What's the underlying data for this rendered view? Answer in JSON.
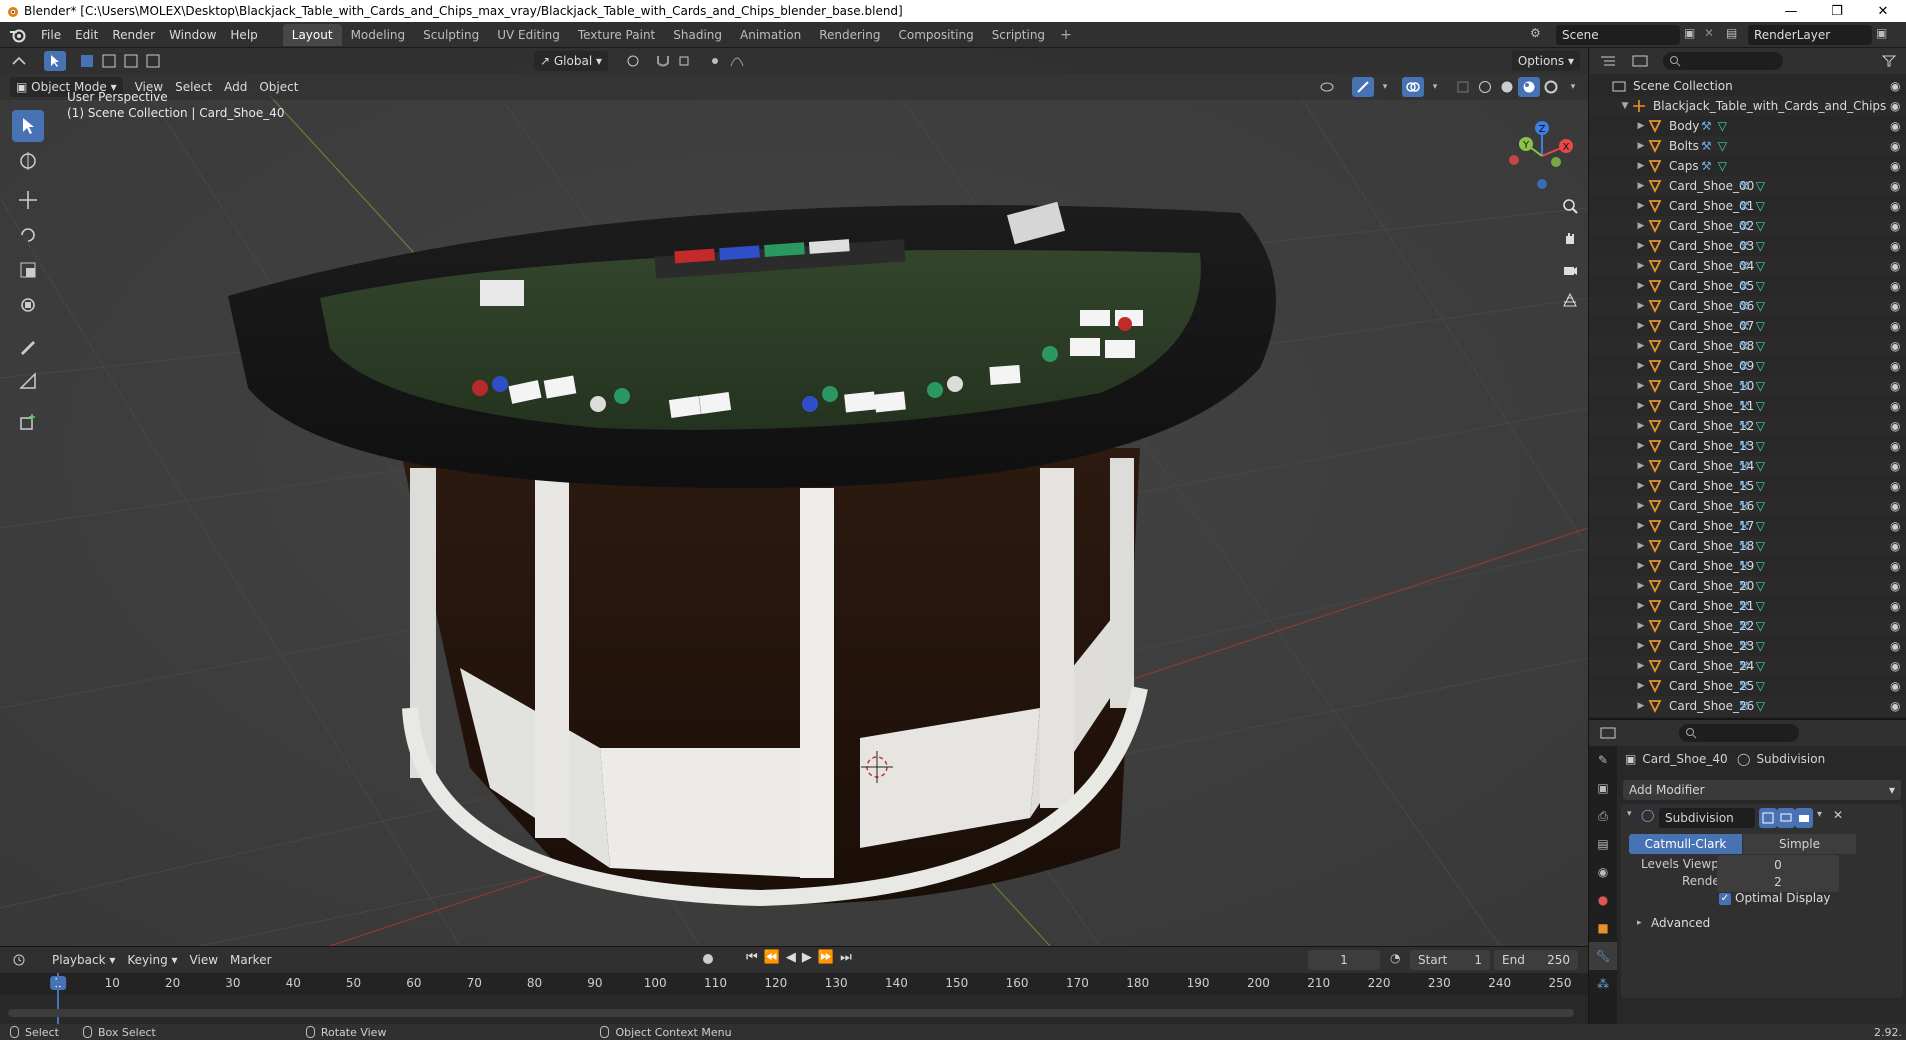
{
  "window": {
    "title": "Blender* [C:\\Users\\MOLEX\\Desktop\\Blackjack_Table_with_Cards_and_Chips_max_vray/Blackjack_Table_with_Cards_and_Chips_blender_base.blend]",
    "minimize": "—",
    "maximize": "❐",
    "close": "✕"
  },
  "menu": [
    "File",
    "Edit",
    "Render",
    "Window",
    "Help"
  ],
  "workspaces": [
    "Layout",
    "Modeling",
    "Sculpting",
    "UV Editing",
    "Texture Paint",
    "Shading",
    "Animation",
    "Rendering",
    "Compositing",
    "Scripting"
  ],
  "active_workspace": "Layout",
  "scene": {
    "name": "Scene",
    "render_layer": "RenderLayer"
  },
  "viewport": {
    "orientation": "Global",
    "options": "Options",
    "mode": "Object Mode",
    "menus": [
      "View",
      "Select",
      "Add",
      "Object"
    ],
    "info_line1": "User Perspective",
    "info_line2": "(1) Scene Collection | Card_Shoe_40",
    "axes": {
      "x": "X",
      "y": "Y",
      "z": "Z"
    }
  },
  "outliner": {
    "root": "Scene Collection",
    "collection": "Blackjack_Table_with_Cards_and_Chips",
    "items": [
      "Body",
      "Bolts",
      "Caps",
      "Card_Shoe_00",
      "Card_Shoe_01",
      "Card_Shoe_02",
      "Card_Shoe_03",
      "Card_Shoe_04",
      "Card_Shoe_05",
      "Card_Shoe_06",
      "Card_Shoe_07",
      "Card_Shoe_08",
      "Card_Shoe_09",
      "Card_Shoe_10",
      "Card_Shoe_11",
      "Card_Shoe_12",
      "Card_Shoe_13",
      "Card_Shoe_14",
      "Card_Shoe_15",
      "Card_Shoe_16",
      "Card_Shoe_17",
      "Card_Shoe_18",
      "Card_Shoe_19",
      "Card_Shoe_20",
      "Card_Shoe_21",
      "Card_Shoe_22",
      "Card_Shoe_23",
      "Card_Shoe_24",
      "Card_Shoe_25",
      "Card_Shoe_26"
    ]
  },
  "properties": {
    "object": "Card_Shoe_40",
    "modifier_tab": "Subdivision",
    "add_modifier": "Add Modifier",
    "modifier_name": "Subdivision",
    "type_catmull": "Catmull-Clark",
    "type_simple": "Simple",
    "levels_viewport_label": "Levels Viewport",
    "levels_viewport": "0",
    "render_label": "Render",
    "render_value": "2",
    "optimal_display": "Optimal Display",
    "advanced": "Advanced"
  },
  "timeline": {
    "menus": [
      "Playback",
      "Keying",
      "View",
      "Marker"
    ],
    "current_frame": "1",
    "start_label": "Start",
    "start": "1",
    "end_label": "End",
    "end": "250",
    "ticks": [
      "1",
      "10",
      "20",
      "30",
      "40",
      "50",
      "60",
      "70",
      "80",
      "90",
      "100",
      "110",
      "120",
      "130",
      "140",
      "150",
      "160",
      "170",
      "180",
      "190",
      "200",
      "210",
      "220",
      "230",
      "240",
      "250"
    ]
  },
  "status": {
    "select": "Select",
    "box_select": "Box Select",
    "rotate_view": "Rotate View",
    "context_menu": "Object Context Menu",
    "version": "2.92."
  },
  "colors": {
    "accent": "#4772b3",
    "mesh_icon": "#e8922c",
    "modifier_icon": "#6fa8dc",
    "data_icon": "#3dd6a3",
    "axis_x": "#e8474b",
    "axis_y": "#8bc34a",
    "axis_z": "#3d7fe6"
  }
}
